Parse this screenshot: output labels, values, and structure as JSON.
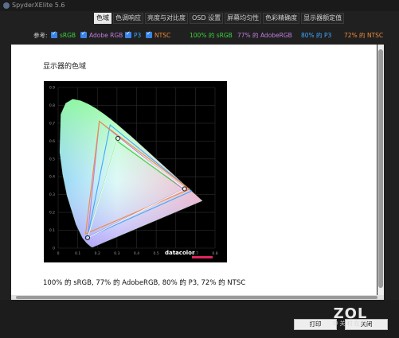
{
  "window": {
    "title": "SpyderXElite 5.6"
  },
  "tabs": [
    {
      "label": "色域",
      "active": true
    },
    {
      "label": "色调响应",
      "active": false
    },
    {
      "label": "亮度与对比度",
      "active": false
    },
    {
      "label": "OSD 设置",
      "active": false
    },
    {
      "label": "屏幕均匀性",
      "active": false
    },
    {
      "label": "色彩精确度",
      "active": false
    },
    {
      "label": "显示器额定值",
      "active": false
    }
  ],
  "legend": {
    "reference_label": "参考:",
    "items": [
      {
        "label": "sRGB",
        "color": "#3dd13d"
      },
      {
        "label": "Adobe RGB",
        "color": "#c07ee0"
      },
      {
        "label": "P3",
        "color": "#3ea8ff"
      },
      {
        "label": "NTSC",
        "color": "#f08a3c"
      }
    ],
    "results": [
      {
        "text": "100% 的 sRGB",
        "color": "#3dd13d"
      },
      {
        "text": "77% 的 AdobeRGB",
        "color": "#c07ee0"
      },
      {
        "text": "80% 的 P3",
        "color": "#3ea8ff"
      },
      {
        "text": "72% 的 NTSC",
        "color": "#f08a3c"
      }
    ]
  },
  "panel": {
    "heading": "显示器的色域",
    "summary": "100% 的 sRGB, 77% 的 AdobeRGB, 80% 的 P3, 72% 的 NTSC",
    "chart_logo": "datacolor"
  },
  "chart_data": {
    "type": "scatter",
    "title": "",
    "xlabel": "",
    "ylabel": "",
    "xlim": [
      0,
      0.8
    ],
    "ylim": [
      0,
      0.9
    ],
    "x_ticks": [
      "0",
      "0.1",
      "0.2",
      "0.3",
      "0.4",
      "0.5",
      "0.6",
      "0.7",
      "0.8"
    ],
    "y_ticks": [
      "0",
      "0.1",
      "0.2",
      "0.3",
      "0.4",
      "0.5",
      "0.6",
      "0.7",
      "0.8",
      "0.9"
    ],
    "grid": true,
    "spectral_locus": [
      [
        0.175,
        0.005
      ],
      [
        0.166,
        0.009
      ],
      [
        0.144,
        0.03
      ],
      [
        0.124,
        0.058
      ],
      [
        0.091,
        0.133
      ],
      [
        0.045,
        0.295
      ],
      [
        0.023,
        0.413
      ],
      [
        0.008,
        0.538
      ],
      [
        0.014,
        0.75
      ],
      [
        0.039,
        0.812
      ],
      [
        0.074,
        0.834
      ],
      [
        0.114,
        0.826
      ],
      [
        0.155,
        0.806
      ],
      [
        0.193,
        0.782
      ],
      [
        0.23,
        0.754
      ],
      [
        0.266,
        0.724
      ],
      [
        0.302,
        0.692
      ],
      [
        0.373,
        0.625
      ],
      [
        0.444,
        0.555
      ],
      [
        0.512,
        0.487
      ],
      [
        0.575,
        0.424
      ],
      [
        0.627,
        0.372
      ],
      [
        0.735,
        0.265
      ]
    ],
    "series": [
      {
        "name": "sRGB",
        "points": [
          [
            0.64,
            0.33
          ],
          [
            0.3,
            0.6
          ],
          [
            0.15,
            0.06
          ]
        ]
      },
      {
        "name": "Adobe RGB",
        "points": [
          [
            0.64,
            0.33
          ],
          [
            0.21,
            0.71
          ],
          [
            0.15,
            0.06
          ]
        ]
      },
      {
        "name": "P3",
        "points": [
          [
            0.68,
            0.32
          ],
          [
            0.265,
            0.69
          ],
          [
            0.15,
            0.06
          ]
        ]
      },
      {
        "name": "NTSC",
        "points": [
          [
            0.67,
            0.33
          ],
          [
            0.21,
            0.71
          ],
          [
            0.14,
            0.08
          ]
        ]
      }
    ],
    "measured": {
      "points": [
        [
          0.645,
          0.332
        ],
        [
          0.305,
          0.615
        ],
        [
          0.15,
          0.058
        ]
      ]
    }
  },
  "buttons": {
    "print": "打印",
    "close": "关闭"
  },
  "watermark": {
    "big": "ZOL",
    "small": "中关村在线"
  }
}
